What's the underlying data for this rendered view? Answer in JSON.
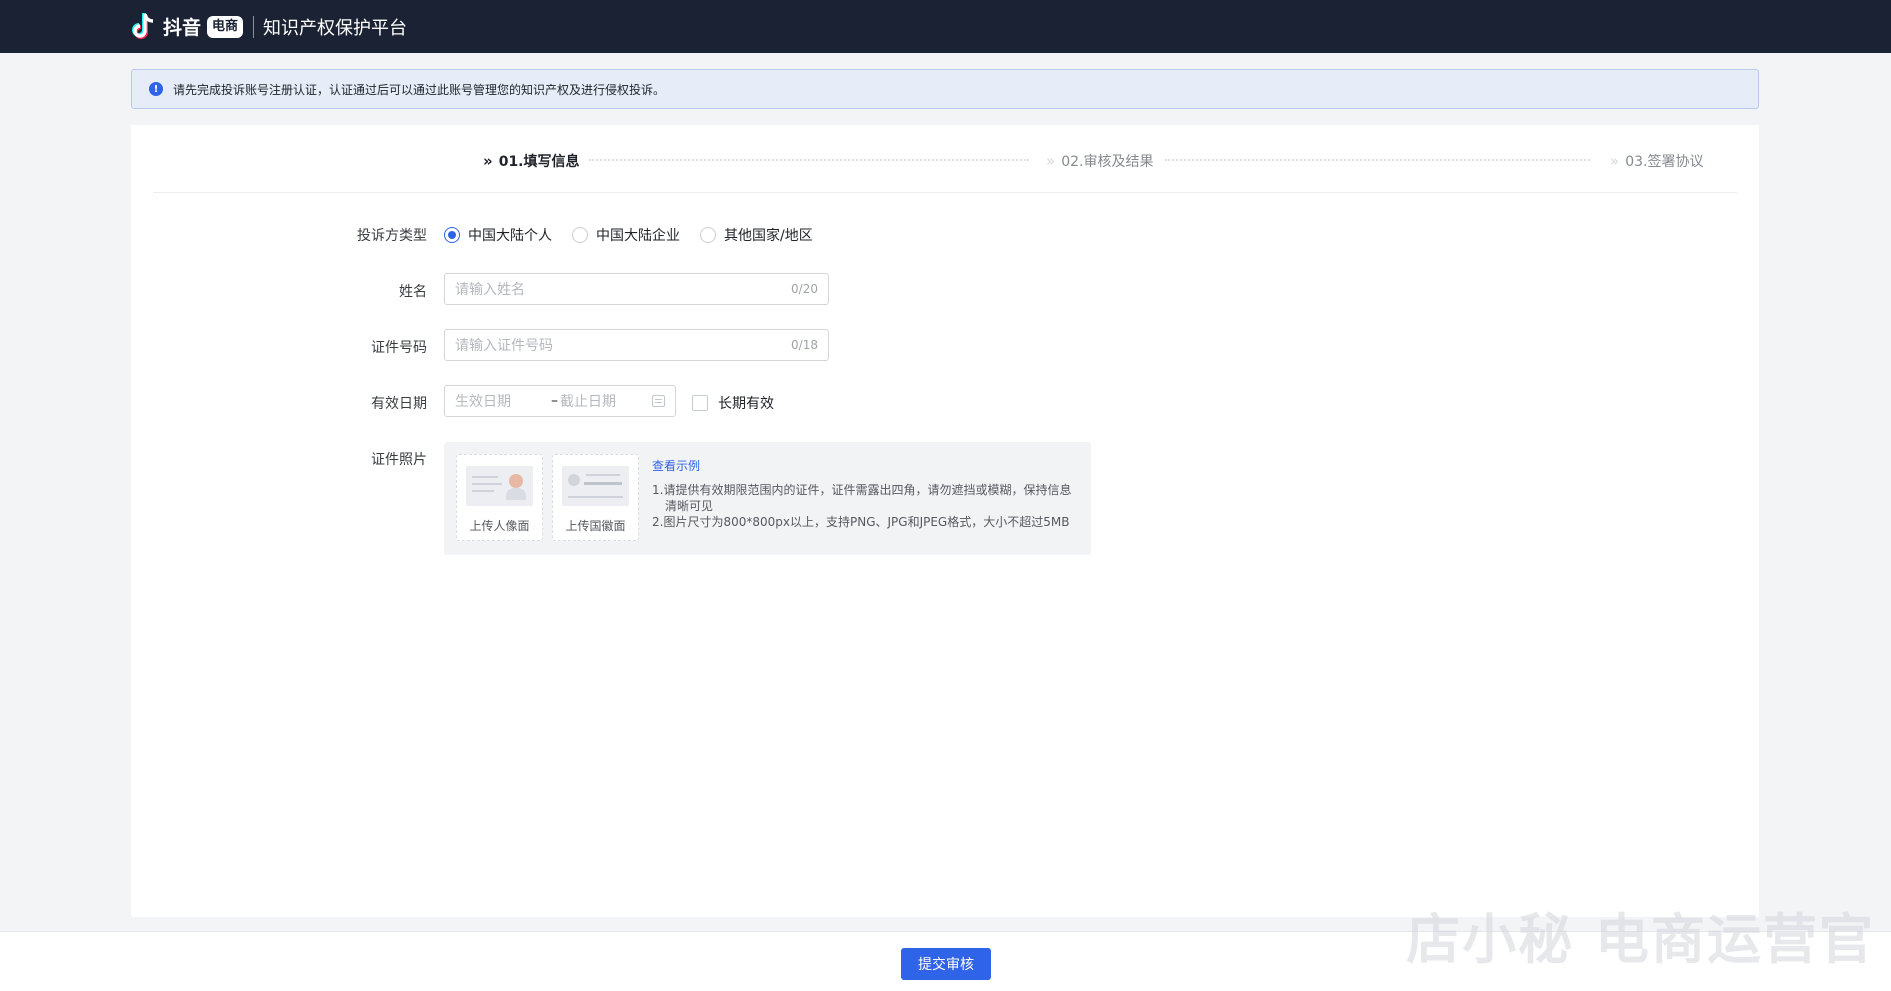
{
  "header": {
    "brand_text": "抖音",
    "brand_badge": "电商",
    "platform_title": "知识产权保护平台"
  },
  "notice": {
    "icon": "info-icon",
    "text": "请先完成投诉账号注册认证，认证通过后可以通过此账号管理您的知识产权及进行侵权投诉。"
  },
  "steps": [
    {
      "label": "01.填写信息",
      "state": "active"
    },
    {
      "label": "02.审核及结果",
      "state": "inactive"
    },
    {
      "label": "03.签署协议",
      "state": "inactive"
    }
  ],
  "form": {
    "complainant_type": {
      "label": "投诉方类型",
      "options": [
        "中国大陆个人",
        "中国大陆企业",
        "其他国家/地区"
      ],
      "selected": "中国大陆个人"
    },
    "name": {
      "label": "姓名",
      "placeholder": "请输入姓名",
      "counter": "0/20"
    },
    "id_number": {
      "label": "证件号码",
      "placeholder": "请输入证件号码",
      "counter": "0/18"
    },
    "validity": {
      "label": "有效日期",
      "start_placeholder": "生效日期",
      "separator": "–",
      "end_placeholder": "截止日期",
      "long_term_label": "长期有效"
    },
    "photos": {
      "label": "证件照片",
      "upload_portrait": "上传人像面",
      "upload_emblem": "上传国徽面",
      "example_link": "查看示例",
      "tip1_a": "1.请提供有效期限范围内的证件，证件需露出四角，请勿遮挡或模糊，保持信息",
      "tip1_b": "清晰可见",
      "tip2": "2.图片尺寸为800*800px以上，支持PNG、JPG和JPEG格式，大小不超过5MB"
    }
  },
  "footer": {
    "submit_label": "提交审核",
    "watermark": "店小秘 电商运营官"
  },
  "colors": {
    "accent": "#2f63e8",
    "header_bg": "#1a2233",
    "notice_bg": "#e6ecf8"
  }
}
